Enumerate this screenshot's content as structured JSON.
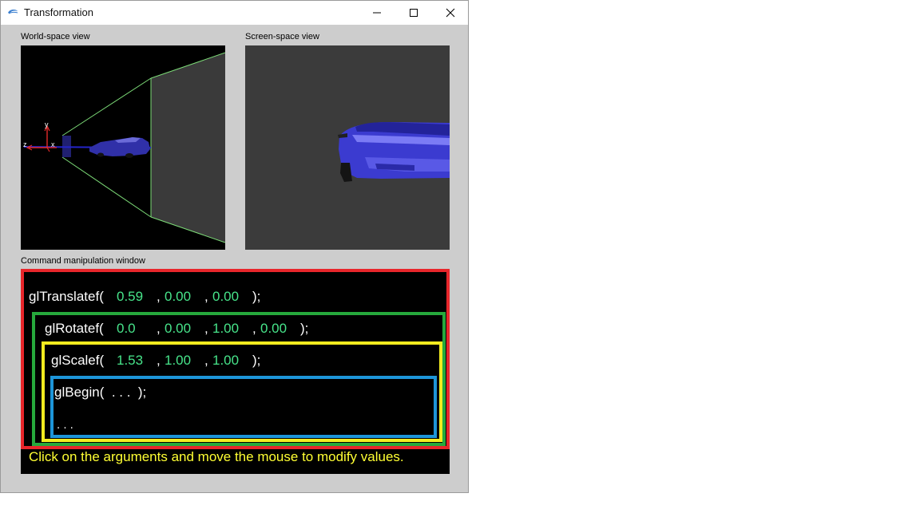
{
  "window": {
    "title": "Transformation",
    "minimize_icon": "minimize-icon",
    "maximize_icon": "maximize-icon",
    "close_icon": "close-icon"
  },
  "world_view": {
    "label": "World-space view",
    "axis_labels": {
      "y": "y",
      "z": "z",
      "x": "x"
    },
    "background": "#000000",
    "frustum_color": "#7ddc78",
    "axis_color": "#e52a2a"
  },
  "screen_view": {
    "label": "Screen-space view",
    "background": "#3b3b3b"
  },
  "command": {
    "label": "Command manipulation window",
    "translate": {
      "fn": "glTranslatef(",
      "args": [
        "0.59",
        "0.00",
        "0.00"
      ],
      "end": ");"
    },
    "rotate": {
      "fn": "glRotatef(",
      "args": [
        "0.0",
        "0.00",
        "1.00",
        "0.00"
      ],
      "end": ");"
    },
    "scale": {
      "fn": "glScalef(",
      "args": [
        "1.53",
        "1.00",
        "1.00"
      ],
      "end": ");"
    },
    "begin": {
      "text": "glBegin(  . . .  );"
    },
    "ellipsis": ". . .",
    "comma": ",",
    "hint": "Click on the arguments and move the mouse to modify values.",
    "colors": {
      "red": "#e8262b",
      "green": "#26a93c",
      "yellow": "#f3ec1f",
      "blue": "#1d95d9",
      "arg": "#47e48a",
      "hint": "#ffff33"
    }
  }
}
